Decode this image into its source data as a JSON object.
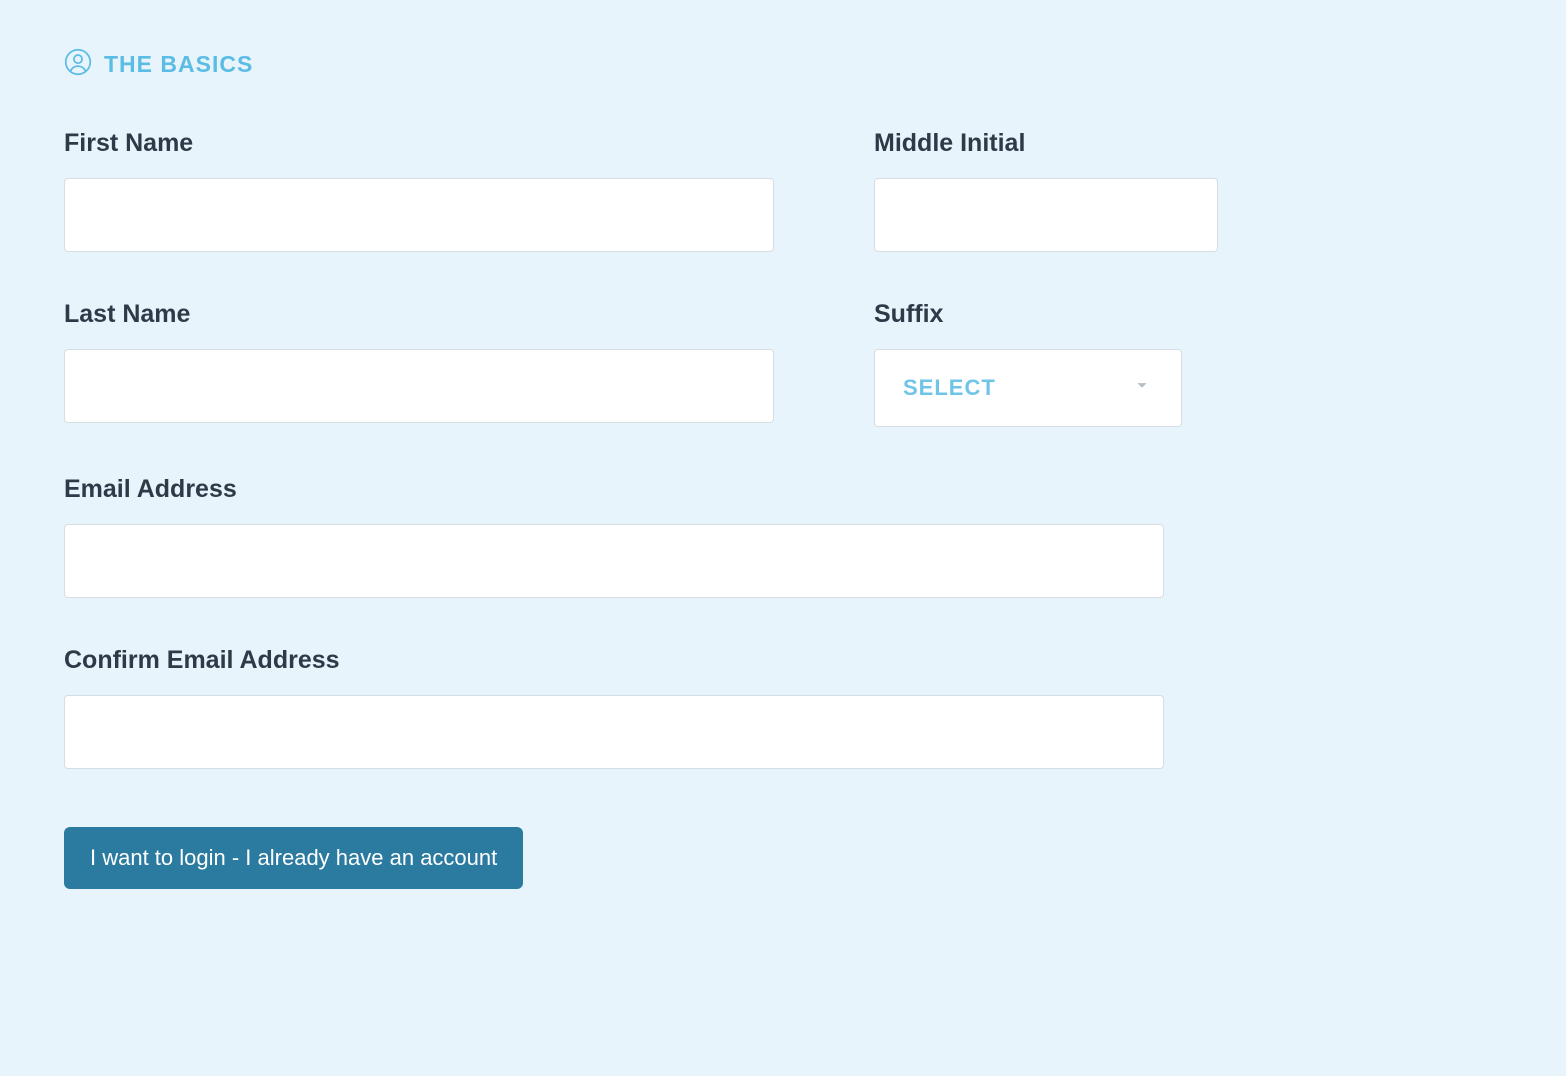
{
  "section": {
    "title": "THE BASICS"
  },
  "form": {
    "first_name_label": "First Name",
    "first_name_value": "",
    "middle_initial_label": "Middle Initial",
    "middle_initial_value": "",
    "last_name_label": "Last Name",
    "last_name_value": "",
    "suffix_label": "Suffix",
    "suffix_selected": "SELECT",
    "email_label": "Email Address",
    "email_value": "",
    "confirm_email_label": "Confirm Email Address",
    "confirm_email_value": ""
  },
  "actions": {
    "login_button": "I want to login - I already have an account"
  }
}
